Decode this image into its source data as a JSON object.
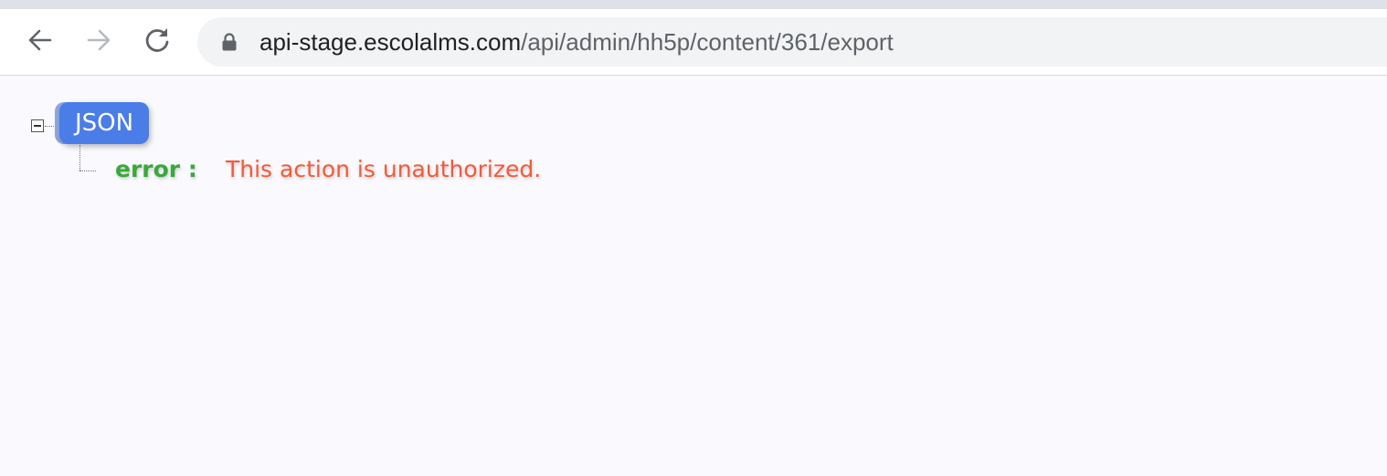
{
  "browser": {
    "url_host": "api-stage.escolalms.com",
    "url_path": "/api/admin/hh5p/content/361/export",
    "icons": {
      "back": "arrow-left-icon",
      "forward": "arrow-right-icon",
      "reload": "reload-icon",
      "lock": "lock-icon"
    }
  },
  "json_viewer": {
    "root_label": "JSON",
    "properties": [
      {
        "key": "error :",
        "value": "This action is unauthorized."
      }
    ],
    "colors": {
      "badge": "#4a7de8",
      "key": "#3aa83a",
      "value": "#f45a36"
    }
  }
}
